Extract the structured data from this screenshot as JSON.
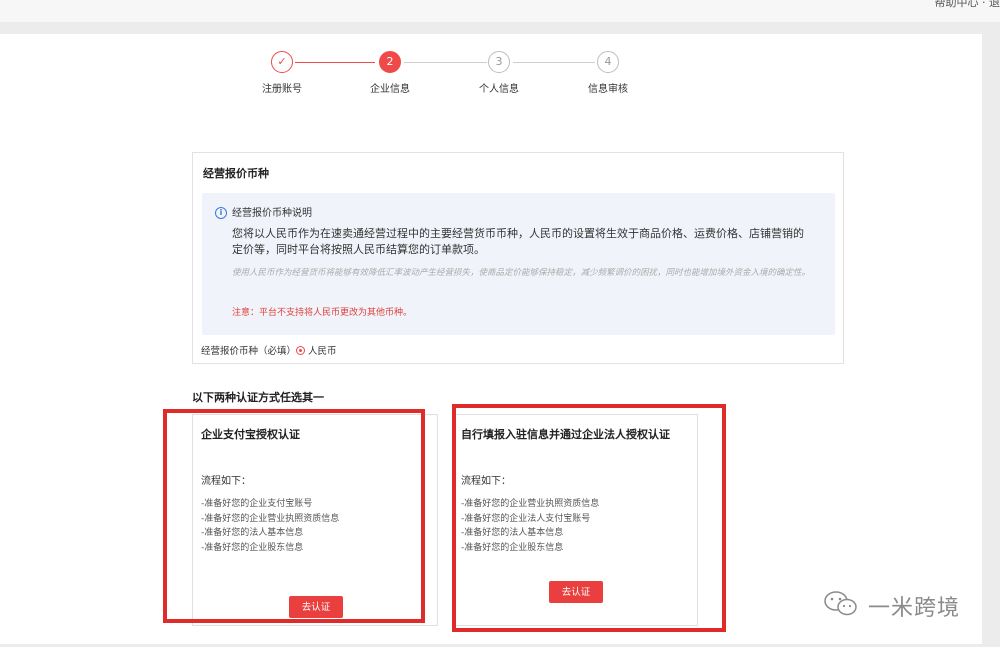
{
  "topbar": {
    "right_text": "帮助中心 · 退"
  },
  "stepper": {
    "steps": [
      {
        "label": "注册账号",
        "num": "✓",
        "state": "done"
      },
      {
        "label": "企业信息",
        "num": "2",
        "state": "active"
      },
      {
        "label": "个人信息",
        "num": "3",
        "state": "todo"
      },
      {
        "label": "信息审核",
        "num": "4",
        "state": "todo"
      }
    ]
  },
  "currency": {
    "panel_title": "经营报价币种",
    "notice_heading": "经营报价币种说明",
    "notice_body": "您将以人民币作为在速卖通经营过程中的主要经营货币币种，人民币的设置将生效于商品价格、运费价格、店铺营销的定价等，同时平台将按照人民币结算您的订单款项。",
    "notice_hint": "使用人民币作为经营货币将能够有效降低汇率波动产生经营损失，使商品定价能够保持稳定，减少频繁调价的困扰，同时也能增加境外资金入境的确定性。",
    "notice_warning": "注意：平台不支持将人民币更改为其他币种。",
    "field_label": "经营报价币种（必填）",
    "selected_option": "人民币"
  },
  "verify": {
    "section_title": "以下两种认证方式任选其一",
    "cards": [
      {
        "title": "企业支付宝授权认证",
        "flow_label": "流程如下：",
        "steps": [
          "-准备好您的企业支付宝账号",
          "-准备好您的企业营业执照资质信息",
          "-准备好您的法人基本信息",
          "-准备好您的企业股东信息"
        ],
        "button": "去认证"
      },
      {
        "title": "自行填报入驻信息并通过企业法人授权认证",
        "flow_label": "流程如下：",
        "steps": [
          "-准备好您的企业营业执照资质信息",
          "-准备好您的企业法人支付宝账号",
          "-准备好您的法人基本信息",
          "-准备好您的企业股东信息"
        ],
        "button": "去认证"
      }
    ]
  },
  "colors": {
    "accent": "#f0494a",
    "highlight": "#e02b2b",
    "notice_bg": "#f0f4fa",
    "warning": "#e0403c"
  },
  "watermark": {
    "text": "一米跨境"
  }
}
